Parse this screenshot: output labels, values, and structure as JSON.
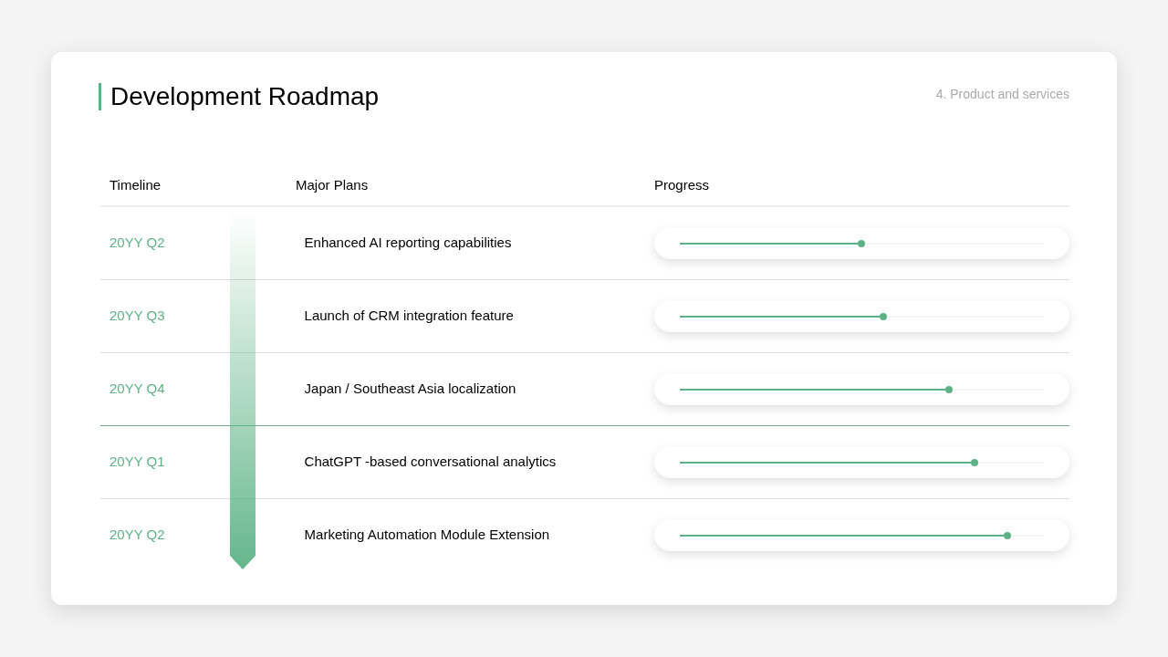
{
  "title": "Development Roadmap",
  "section": "4. Product and services",
  "columns": [
    "Timeline",
    "Major Plans",
    "Progress"
  ],
  "rows": [
    {
      "timeline": "20YY Q2",
      "plan": "Enhanced AI reporting capabilities",
      "level": 0.5,
      "year_break": false
    },
    {
      "timeline": "20YY Q3",
      "plan": "Launch of CRM integration feature",
      "level": 0.56,
      "year_break": false
    },
    {
      "timeline": "20YY Q4",
      "plan": "Japan / Southeast Asia localization",
      "level": 0.74,
      "year_break": false
    },
    {
      "timeline": "20YY Q1",
      "plan": "ChatGPT -based conversational analytics",
      "level": 0.81,
      "year_break": true
    },
    {
      "timeline": "20YY Q2",
      "plan": "Marketing Automation Module Extension",
      "level": 0.9,
      "year_break": false
    }
  ]
}
